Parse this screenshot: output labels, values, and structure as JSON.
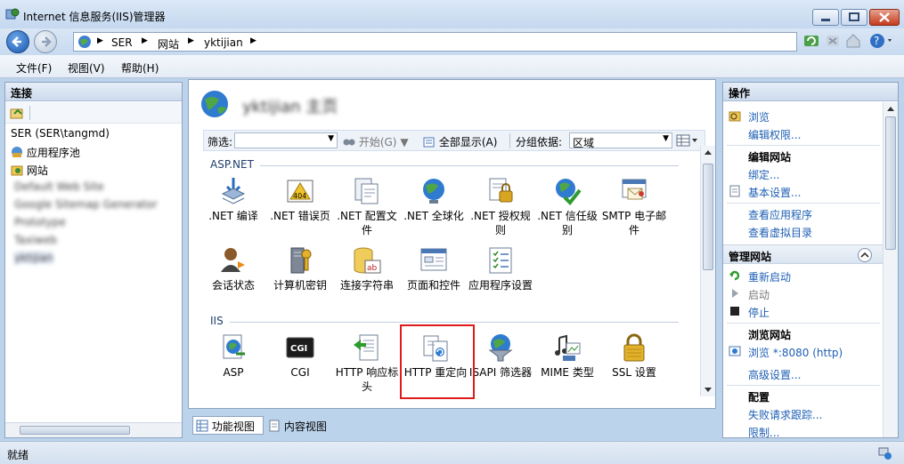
{
  "window": {
    "title": "Internet 信息服务(IIS)管理器"
  },
  "address": {
    "crumbs": [
      "SER",
      "网站",
      "yktijian"
    ]
  },
  "menu": {
    "items": [
      "文件(F)",
      "视图(V)",
      "帮助(H)"
    ]
  },
  "left": {
    "header": "连接",
    "tree_root": "SER (SER\\tangmd)",
    "app_pool": "应用程序池",
    "sites": "网站",
    "blurred_sites": [
      "Default Web Site",
      "Google Sitemap Generator",
      "Prototype",
      "Taxiweb",
      "yktijian"
    ]
  },
  "center": {
    "title": "yktijian 主页",
    "filter_label": "筛选:",
    "start_label": "开始(G)",
    "show_all_label": "全部显示(A)",
    "group_label": "分组依据:",
    "group_value": "区域",
    "sections": {
      "aspnet": "ASP.NET",
      "iis": "IIS"
    },
    "aspnet_tiles": [
      ".NET 编译",
      ".NET 错误页",
      ".NET 配置文件",
      ".NET 全球化",
      ".NET 授权规则",
      ".NET 信任级别",
      "SMTP 电子邮件",
      "会话状态",
      "计算机密钥",
      "连接字符串",
      "页面和控件",
      "应用程序设置"
    ],
    "iis_tiles": [
      "ASP",
      "CGI",
      "HTTP 响应标头",
      "HTTP 重定向",
      "ISAPI 筛选器",
      "MIME 类型",
      "SSL 设置"
    ],
    "cgi_badge": "CGI",
    "error_badge": "404"
  },
  "view_tabs": {
    "features": "功能视图",
    "content": "内容视图"
  },
  "right": {
    "header": "操作",
    "browse": "浏览",
    "edit_permissions": "编辑权限...",
    "edit_site_head": "编辑网站",
    "bindings": "绑定...",
    "basic_settings": "基本设置...",
    "view_apps": "查看应用程序",
    "view_vdirs": "查看虚拟目录",
    "manage_head": "管理网站",
    "restart": "重新启动",
    "start": "启动",
    "stop": "停止",
    "browse_site_head": "浏览网站",
    "browse_port": "浏览 *:8080 (http)",
    "advanced": "高级设置...",
    "config_head": "配置",
    "failed_trace": "失败请求跟踪...",
    "limits": "限制..."
  },
  "status": {
    "text": "就绪"
  },
  "colors": {
    "link": "#1e5fb4",
    "highlight": "#e01b1b",
    "panel_bg": "#bcd3ec"
  }
}
